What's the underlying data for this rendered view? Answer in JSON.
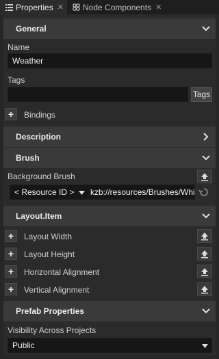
{
  "tabs": [
    {
      "label": "Properties",
      "icon": "properties-icon",
      "active": true
    },
    {
      "label": "Node Components",
      "icon": "node-components-icon",
      "active": false
    }
  ],
  "general": {
    "title": "General",
    "name_label": "Name",
    "name_value": "Weather",
    "tags_label": "Tags",
    "tags_value": "",
    "tags_button": "Tags",
    "bindings_label": "Bindings"
  },
  "description": {
    "title": "Description"
  },
  "brush": {
    "title": "Brush",
    "background_label": "Background Brush",
    "resource_type": "< Resource ID >",
    "resource_value": "kzb://resources/Brushes/Whi"
  },
  "layout_item": {
    "title": "Layout.Item",
    "rows": [
      {
        "label": "Layout Width"
      },
      {
        "label": "Layout Height"
      },
      {
        "label": "Horizontal Alignment"
      },
      {
        "label": "Vertical Alignment"
      }
    ]
  },
  "prefab": {
    "title": "Prefab Properties",
    "visibility_label": "Visibility Across Projects",
    "visibility_value": "Public"
  },
  "colors": {
    "background": "#262626",
    "header": "#3a3a3a",
    "field": "#161616"
  }
}
